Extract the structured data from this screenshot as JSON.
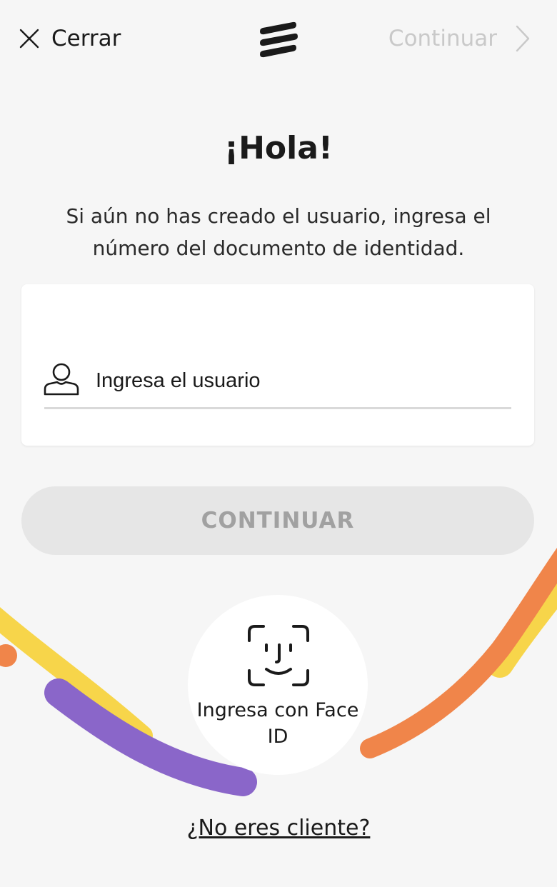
{
  "header": {
    "close_label": "Cerrar",
    "continue_label": "Continuar",
    "close_icon": "close-icon",
    "logo_icon": "brand-logo-icon",
    "continue_icon": "chevron-right-icon"
  },
  "main": {
    "title": "¡Hola!",
    "subtitle": "Si aún no has creado el usuario, ingresa el número del documento de identidad."
  },
  "form": {
    "user_placeholder": "Ingresa el usuario",
    "user_value": "",
    "user_icon": "user-icon",
    "continue_button": "CONTINUAR"
  },
  "faceid": {
    "label": "Ingresa con Face ID",
    "icon": "face-id-icon"
  },
  "footer": {
    "no_client_link": "¿No eres cliente?"
  },
  "colors": {
    "background": "#f6f6f6",
    "button_disabled_bg": "#e6e6e6",
    "button_disabled_text": "#a1a1a1",
    "yellow": "#f7d54a",
    "orange": "#f0854a",
    "purple": "#8a66c9"
  }
}
